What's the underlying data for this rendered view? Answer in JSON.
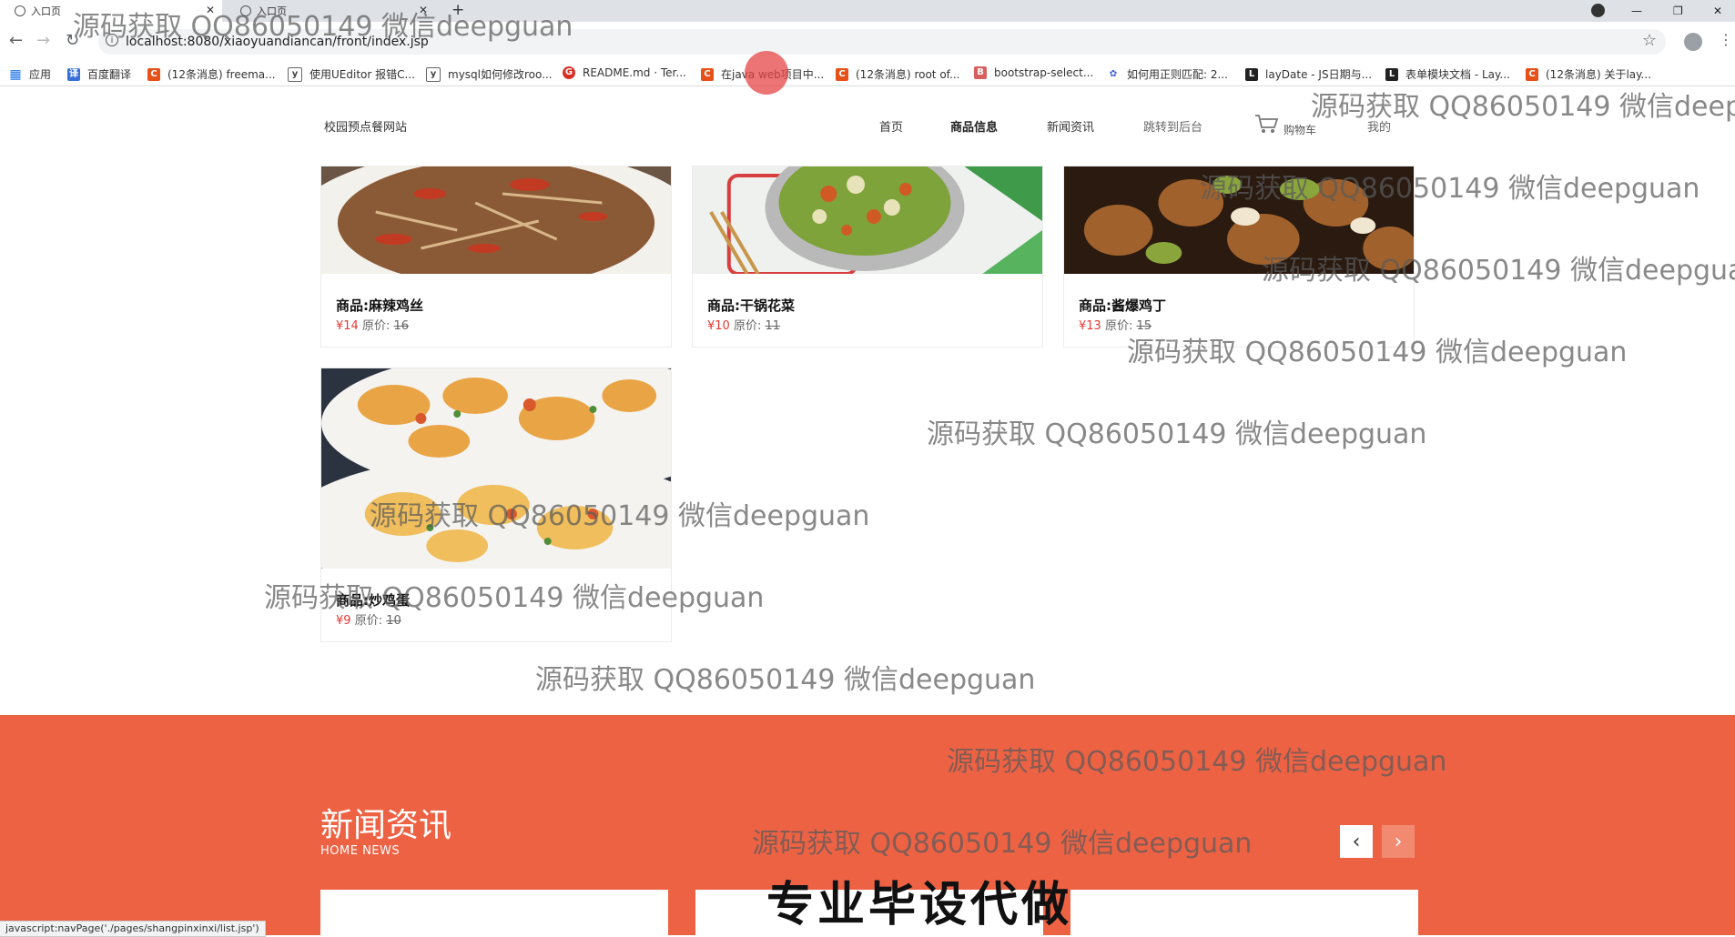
{
  "browser": {
    "tabs": [
      {
        "label": "入口页",
        "active": true
      },
      {
        "label": "入口页",
        "active": false
      }
    ],
    "new_tab": "+",
    "url": "localhost:8080/xiaoyuandiancan/front/index.jsp",
    "bookmarks": [
      {
        "label": "应用",
        "icon": "apps-grid-icon"
      },
      {
        "label": "百度翻译",
        "icon": "baidu-translate-icon"
      },
      {
        "label": "(12条消息) freema...",
        "icon": "csdn-icon"
      },
      {
        "label": "使用UEditor 报错C...",
        "icon": "leaf-icon"
      },
      {
        "label": "mysql如何修改roo...",
        "icon": "leaf-icon"
      },
      {
        "label": "README.md · Ter...",
        "icon": "gitee-icon"
      },
      {
        "label": "在java web项目中...",
        "icon": "csdn-icon"
      },
      {
        "label": "(12条消息) root of...",
        "icon": "csdn-icon"
      },
      {
        "label": "bootstrap-select...",
        "icon": "bootstrap-icon"
      },
      {
        "label": "如何用正则匹配: 2...",
        "icon": "baidu-paw-icon"
      },
      {
        "label": "layDate - JS日期与...",
        "icon": "layui-icon"
      },
      {
        "label": "表单模块文档 - Lay...",
        "icon": "layui-icon"
      },
      {
        "label": "(12条消息) 关于lay...",
        "icon": "csdn-icon"
      }
    ],
    "status_url": "javascript:navPage('./pages/shangpinxinxi/list.jsp')"
  },
  "site": {
    "title": "校园预点餐网站",
    "nav": [
      "首页",
      "商品信息",
      "新闻资讯",
      "跳转到后台",
      "购物车",
      "我的"
    ]
  },
  "products": [
    {
      "name": "商品:麻辣鸡丝",
      "price": "¥14",
      "orig_label": "原价:",
      "orig": "16"
    },
    {
      "name": "商品:干锅花菜",
      "price": "¥10",
      "orig_label": "原价:",
      "orig": "11"
    },
    {
      "name": "商品:酱爆鸡丁",
      "price": "¥13",
      "orig_label": "原价:",
      "orig": "15"
    },
    {
      "name": "商品:炒鸡蛋",
      "price": "¥9",
      "orig_label": "原价:",
      "orig": "10"
    }
  ],
  "news": {
    "title": "新闻资讯",
    "subtitle": "HOME NEWS",
    "prev": "‹",
    "next": "›"
  },
  "overlay": {
    "watermark": "源码获取 QQ86050149 微信deepguan",
    "banner": "专业毕设代做"
  },
  "colors": {
    "news_bg": "#ee6244",
    "price_red": "#e53935"
  }
}
